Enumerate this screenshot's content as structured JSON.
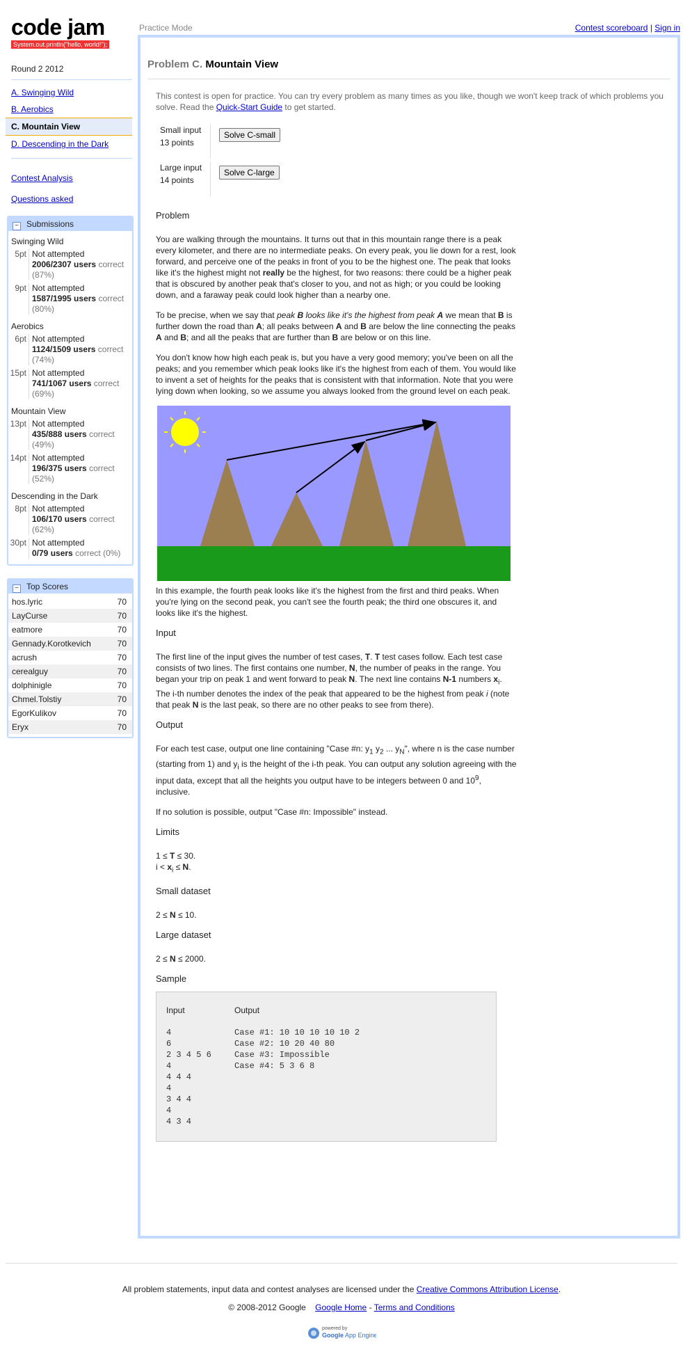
{
  "logo": {
    "title": "code jam",
    "tagline": "System.out.println(\"hello, world!\");"
  },
  "round": "Round 2 2012",
  "problems": [
    {
      "label": "A. Swinging Wild",
      "active": false
    },
    {
      "label": "B. Aerobics",
      "active": false
    },
    {
      "label": "C. Mountain View",
      "active": true
    },
    {
      "label": "D. Descending in the Dark",
      "active": false
    }
  ],
  "side_links": {
    "analysis": "Contest Analysis",
    "questions": "Questions asked"
  },
  "submissions": {
    "title": "Submissions",
    "groups": [
      {
        "name": "Swinging Wild",
        "items": [
          {
            "pt": "5pt",
            "status": "Not attempted",
            "users": "2006/2307 users",
            "pct": "correct (87%)"
          },
          {
            "pt": "9pt",
            "status": "Not attempted",
            "users": "1587/1995 users",
            "pct": "correct (80%)"
          }
        ]
      },
      {
        "name": "Aerobics",
        "items": [
          {
            "pt": "6pt",
            "status": "Not attempted",
            "users": "1124/1509 users",
            "pct": "correct (74%)"
          },
          {
            "pt": "15pt",
            "status": "Not attempted",
            "users": "741/1067 users",
            "pct": "correct (69%)"
          }
        ]
      },
      {
        "name": "Mountain View",
        "items": [
          {
            "pt": "13pt",
            "status": "Not attempted",
            "users": "435/888 users",
            "pct": "correct (49%)"
          },
          {
            "pt": "14pt",
            "status": "Not attempted",
            "users": "196/375 users",
            "pct": "correct (52%)"
          }
        ]
      },
      {
        "name": "Descending in the Dark",
        "items": [
          {
            "pt": "8pt",
            "status": "Not attempted",
            "users": "106/170 users",
            "pct": "correct (62%)"
          },
          {
            "pt": "30pt",
            "status": "Not attempted",
            "users": "0/79 users",
            "pct": "correct (0%)"
          }
        ]
      }
    ]
  },
  "top_scores": {
    "title": "Top Scores",
    "rows": [
      {
        "name": "hos.lyric",
        "score": "70"
      },
      {
        "name": "LayCurse",
        "score": "70"
      },
      {
        "name": "eatmore",
        "score": "70"
      },
      {
        "name": "Gennady.Korotkevich",
        "score": "70"
      },
      {
        "name": "acrush",
        "score": "70"
      },
      {
        "name": "cerealguy",
        "score": "70"
      },
      {
        "name": "dolphinigle",
        "score": "70"
      },
      {
        "name": "Chmel.Tolstiy",
        "score": "70"
      },
      {
        "name": "EgorKulikov",
        "score": "70"
      },
      {
        "name": "Eryx",
        "score": "70"
      }
    ]
  },
  "topbar": {
    "mode": "Practice Mode",
    "scoreboard": "Contest scoreboard",
    "separator": "|",
    "signin": "Sign in"
  },
  "problem": {
    "prefix": "Problem C.",
    "name": "Mountain View",
    "intro_before": "This contest is open for practice. You can try every problem as many times as you like, though we won't keep track of which problems you solve. Read the ",
    "intro_link": "Quick-Start Guide",
    "intro_after": " to get started.",
    "small": {
      "label": "Small input",
      "points": "13 points",
      "button": "Solve C-small"
    },
    "large": {
      "label": "Large input",
      "points": "14 points",
      "button": "Solve C-large"
    }
  },
  "statement": {
    "h_problem": "Problem",
    "p1": "You are walking through the mountains. It turns out that in this mountain range there is a peak every kilometer, and there are no intermediate peaks. On every peak, you lie down for a rest, look forward, and perceive one of the peaks in front of you to be the highest one. The peak that looks like it's the highest might not",
    "p1_bold": "really",
    "p1_end": "be the highest, for two reasons: there could be a higher peak that is obscured by another peak that's closer to you, and not as high; or you could be looking down, and a faraway peak could look higher than a nearby one.",
    "p2": {
      "a": "To be precise, when we say that ",
      "em1": "peak ",
      "emb1": "B",
      "em2": " looks like it's the highest from peak ",
      "emb2": "A",
      "b": " we mean that ",
      "B1": "B",
      "c": " is further down the road than ",
      "A1": "A",
      "d": "; all peaks between ",
      "A2": "A",
      "e": " and ",
      "B2": "B",
      "f": " are below the line connecting the peaks ",
      "A3": "A",
      "g": " and ",
      "B3": "B",
      "h": "; and all the peaks that are further than ",
      "B4": "B",
      "i": " are below or on this line."
    },
    "p3": "You don't know how high each peak is, but you have a very good memory; you've been on all the peaks; and you remember which peak looks like it's the highest from each of them. You would like to invent a set of heights for the peaks that is consistent with that information. Note that you were lying down when looking, so we assume you always looked from the ground level on each peak.",
    "caption": "In this example, the fourth peak looks like it's the highest from the first and third peaks. When you're lying on the second peak, you can't see the fourth peak; the third one obscures it, and looks like it's the highest.",
    "h_input": "Input",
    "input": {
      "a": "The first line of the input gives the number of test cases, ",
      "T1": "T",
      "b": ". ",
      "T2": "T",
      "c": " test cases follow. Each test case consists of two lines. The first contains one number, ",
      "N1": "N",
      "d": ", the number of peaks in the range. You began your trip on peak 1 and went forward to peak ",
      "N2": "N",
      "e": ". The next line contains ",
      "N3": "N-1",
      "f": " numbers ",
      "x": "x",
      "xi": "i",
      "g": ". The i-th number denotes the index of the peak that appeared to be the highest from peak ",
      "i": "i",
      "h": " (note that peak ",
      "N4": "N",
      "j": " is the last peak, so there are no other peaks to see from there)."
    },
    "h_output": "Output",
    "output": {
      "a": "For each test case, output one line containing \"Case #n: y",
      "s1": "1",
      "b": " y",
      "s2": "2",
      "c": " ... y",
      "sN": "N",
      "d": "\", where n is the case number (starting from 1) and y",
      "si": "i",
      "e": " is the height of the i-th peak. You can output any solution agreeing with the input data, except that all the heights you output have to be integers between 0 and 10",
      "exp": "9",
      "f": ", inclusive."
    },
    "impossible": "If no solution is possible, output \"Case #n: Impossible\" instead.",
    "h_limits": "Limits",
    "limits": {
      "l1a": "1 ≤ ",
      "T": "T",
      "l1b": " ≤ 30.",
      "l2a": "i < ",
      "x": "x",
      "xi": "i",
      "l2b": " ≤ ",
      "N": "N",
      "l2c": "."
    },
    "h_small": "Small dataset",
    "small": {
      "a": "2 ≤ ",
      "N": "N",
      "b": " ≤ 10."
    },
    "h_large": "Large dataset",
    "large": {
      "a": "2 ≤ ",
      "N": "N",
      "b": " ≤ 2000."
    },
    "h_sample": "Sample",
    "sample_input_label": "Input",
    "sample_output_label": "Output",
    "sample_input": "4\n6\n2 3 4 5 6\n4\n4 4 4\n4\n3 4 4\n4\n4 3 4",
    "sample_output": "Case #1: 10 10 10 10 10 2\nCase #2: 10 20 40 80\nCase #3: Impossible\nCase #4: 5 3 6 8"
  },
  "footer": {
    "license_text": "All problem statements, input data and contest analyses are licensed under the ",
    "license_link": "Creative Commons Attribution License",
    "license_end": ".",
    "copyright": "© 2008-2012 Google",
    "home": "Google Home",
    "sep": "-",
    "terms": "Terms and Conditions",
    "powered": "powered by",
    "appengine_google": "Google",
    "appengine_name": "App Engine"
  },
  "colors": {
    "sky": "#9999ff",
    "grass": "#1a9a1a",
    "mountain": "#9b7f50",
    "sun": "#ffff00",
    "panel_border": "#c3d9ff",
    "highlight": "#f6a700"
  }
}
